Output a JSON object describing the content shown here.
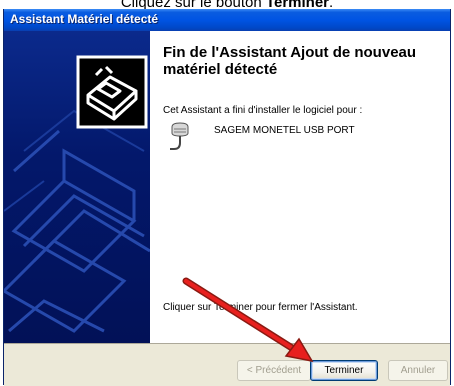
{
  "instruction": {
    "prefix": "Cliquez sur le bouton ",
    "button_name": "Terminer",
    "suffix": "."
  },
  "window": {
    "title": "Assistant Matériel détecté"
  },
  "wizard": {
    "heading": "Fin de l'Assistant Ajout de nouveau matériel détecté",
    "intro": "Cet Assistant a fini d'installer le logiciel pour :",
    "device_icon": "usb-port-icon",
    "device_name": "SAGEM MONETEL USB PORT",
    "finish_hint": "Cliquer sur Terminer pour fermer l'Assistant."
  },
  "buttons": {
    "back": "< Précédent",
    "finish": "Terminer",
    "cancel": "Annuler"
  },
  "colors": {
    "titlebar": "#0054e3",
    "sidebar": "#03186b",
    "footer": "#ece9d8",
    "arrow": "#e8201e"
  }
}
